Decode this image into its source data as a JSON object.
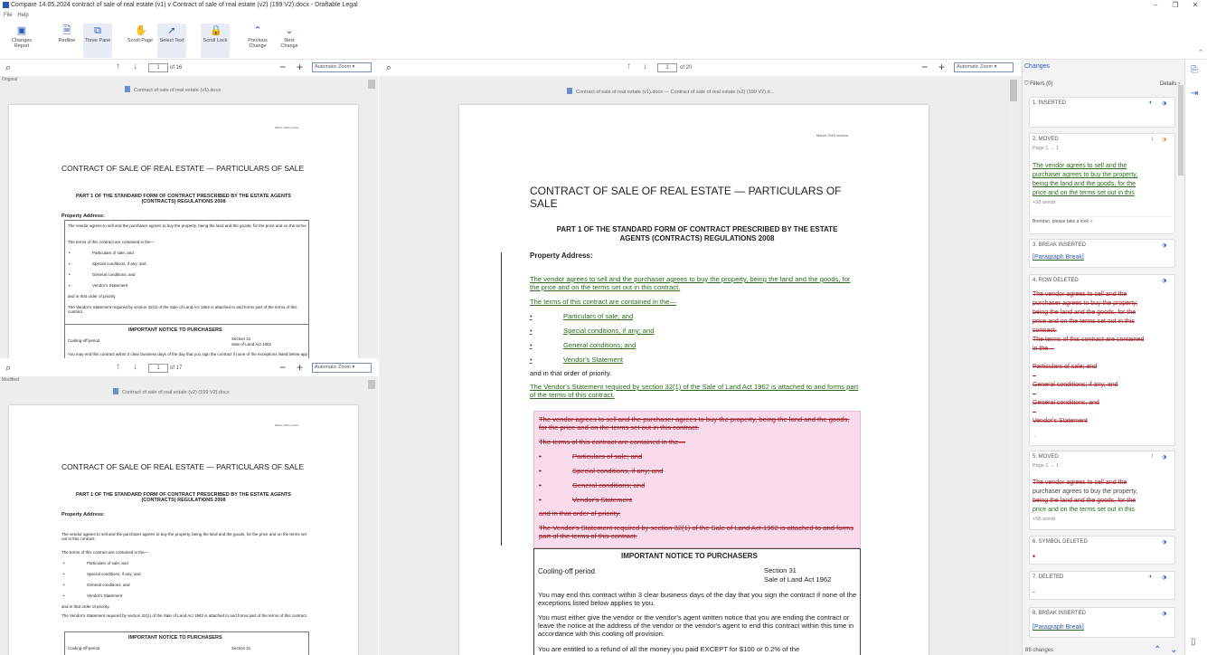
{
  "window": {
    "title": "Compare 14.05.2024 contract of sale of real estate (v1) v Contract of sale of real estate (v2) (199 V2).docx - Draftable Legal",
    "controls": [
      "‒",
      "❐",
      "✕"
    ]
  },
  "menu": [
    "File",
    "Help"
  ],
  "ribbon": {
    "buttons": [
      {
        "label": "Changes Report",
        "icon": "report-icon"
      },
      {
        "label": "Redline",
        "icon": "redline-icon"
      },
      {
        "label": "Three Pane",
        "icon": "three-pane-icon"
      },
      {
        "label": "Scroll Page",
        "icon": "hand-icon"
      },
      {
        "label": "Select Text",
        "icon": "cursor-icon"
      },
      {
        "label": "Scroll Lock",
        "icon": "lock-icon"
      },
      {
        "label": "Previous Change",
        "icon": "chevron-up-icon"
      },
      {
        "label": "Next Change",
        "icon": "chevron-down-icon"
      }
    ],
    "active": [
      "Three Pane",
      "Scroll Lock",
      "Select Text"
    ]
  },
  "left_top": {
    "corner": "Original",
    "page": "1",
    "of": "of 16",
    "zoom": "Automatic Zoom",
    "docname": "Contract of sale of real estate (v1).docx"
  },
  "left_bottom": {
    "corner": "Modified",
    "page": "1",
    "of": "of 17",
    "zoom": "Automatic Zoom",
    "docname": "Contract of sale of real estate (v2) (199 V2).docx"
  },
  "center": {
    "page": "1",
    "of": "of 20",
    "zoom": "Automatic Zoom",
    "docname": "Contract of sale of real estate (v1).docx — Contract of sale of real estate (v2) (199 V2).d..."
  },
  "doc": {
    "date": "March 2019 version",
    "title": "CONTRACT OF SALE OF REAL ESTATE — PARTICULARS OF SALE",
    "part": "PART 1 OF THE STANDARD FORM OF CONTRACT PRESCRIBED BY THE ESTATE AGENTS (CONTRACTS) REGULATIONS 2008",
    "property": "Property Address:",
    "vendor_agrees": "The vendor agrees to sell and the purchaser agrees to buy the property, being the land and the goods, for the price and on the terms set out in this contract.",
    "terms_in": "The terms of this contract are contained in the—",
    "bullets": [
      "Particulars of sale; and",
      "Special conditions, if any; and",
      "General conditions; and",
      "Vendor's Statement"
    ],
    "order": "and in that order of priority.",
    "statement": "The Vendor's Statement required by section 32(1) of the Sale of Land Act 1962 is attached to and forms part of the terms of this contract.",
    "notice": "IMPORTANT NOTICE TO PURCHASERS",
    "cooling": "Cooling-off period",
    "section": "Section 31",
    "act": "Sale of Land Act 1962",
    "may_end": "You may end this contract within 3 clear business days of the day that you sign the contract if none of the exceptions listed below applies to you.",
    "must_give": "You must either give the vendor or the vendor's agent written notice that you are ending the contract or leave the notice at the address of the vendor or the vendor's agent to end this contract within this time in accordance with this cooling off provision.",
    "refund": "You are entitled to a refund of all the money you paid EXCEPT for $100 or 0.2% of the"
  },
  "changes": {
    "title": "Changes",
    "filters": "Filters (0)",
    "details": "Details",
    "items": [
      {
        "label": "1. INSERTED"
      },
      {
        "label": "2. MOVED",
        "sub": "Page 1 → 1",
        "lines": [
          "The vendor agrees to sell and the",
          "purchaser agrees to buy the property,",
          "being the land and the goods, for the",
          "price and on the terms set out in this"
        ],
        "more": "+58 words",
        "comment": "Brendan, please take a look ✓"
      },
      {
        "label": "3. BREAK INSERTED",
        "text": "[Paragraph Break]"
      },
      {
        "label": "4. ROW DELETED",
        "lines": [
          "The vendor agrees to sell and the",
          "purchaser agrees to buy the property,",
          "being the land and the goods, for the",
          "price and on the terms set out in this",
          "contract.",
          "The terms of this contract are contained",
          "in the—",
          "Particulars of sale; and",
          "–",
          "General conditions; if any; and",
          "–",
          "General conditions; and",
          "–",
          "Vendor's Statement"
        ],
        "more": "..."
      },
      {
        "label": "5. MOVED",
        "sub": "Page 1 → 1",
        "lines": [
          "The vendor agrees to sell and the",
          "purchaser agrees to buy the property,",
          "being the land and the goods, for the",
          "price and on the terms set out in this"
        ],
        "more": "+58 words"
      },
      {
        "label": "6. SYMBOL DELETED"
      },
      {
        "label": "7. DELETED"
      },
      {
        "label": "8. BREAK INSERTED",
        "text": "[Paragraph Break]"
      }
    ],
    "count": "88 changes"
  },
  "colors": {
    "accent": "#2a5ab8",
    "inserted": "#2b6b1b",
    "deleted": "#a0202a",
    "moved_bg": "#f9dcec"
  }
}
